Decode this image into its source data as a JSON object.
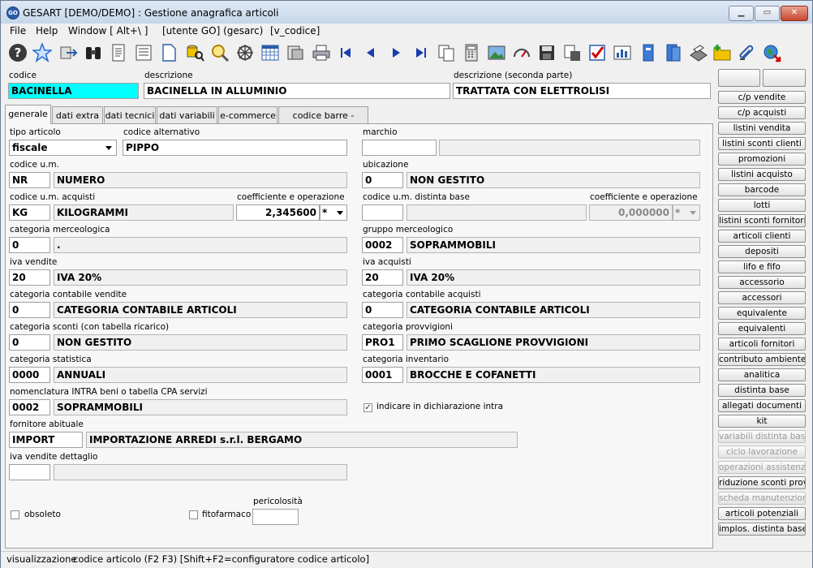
{
  "window": {
    "title": "GESART [DEMO/DEMO] : Gestione anagrafica articoli",
    "app_icon": "GO"
  },
  "menu": [
    "File",
    "Help",
    "Window [ Alt+\\ ]",
    "[utente GO] (gesarc)",
    "[v_codice]"
  ],
  "toolbar_icons": [
    "help-icon",
    "favorite-star-icon",
    "transfer-icon",
    "binoculars-icon",
    "document-list-icon",
    "document-detail-icon",
    "new-document-icon",
    "database-search-icon",
    "search-magnifier-icon",
    "settings-wheel-icon",
    "calendar-grid-icon",
    "database-icon",
    "print-icon",
    "first-record-icon",
    "previous-record-icon",
    "next-record-icon",
    "last-record-icon",
    "copy-icon",
    "calculator-icon",
    "image-icon",
    "gauge-icon",
    "save-icon",
    "save-copy-icon",
    "checklist-icon",
    "chart-icon",
    "file-blue-icon",
    "file-blue-2-icon",
    "scanner-icon",
    "add-folder-icon",
    "attachment-icon",
    "globe-exit-icon"
  ],
  "header": {
    "codice": {
      "label": "codice",
      "value": "BACINELLA"
    },
    "descrizione": {
      "label": "descrizione",
      "value": "BACINELLA IN ALLUMINIO"
    },
    "descrizione2": {
      "label": "descrizione (seconda parte)",
      "value": "TRATTATA CON ELETTROLISI"
    }
  },
  "tabs": [
    {
      "label": "generale",
      "active": true
    },
    {
      "label": "dati extra"
    },
    {
      "label": "dati tecnici"
    },
    {
      "label": "dati variabili"
    },
    {
      "label": "e-commerce"
    },
    {
      "label": "codice barre - colori"
    }
  ],
  "form": {
    "tipo_articolo": {
      "label": "tipo articolo",
      "value": "fiscale"
    },
    "codice_alternativo": {
      "label": "codice alternativo",
      "value": "PIPPO"
    },
    "marchio": {
      "label": "marchio",
      "code": "",
      "desc": ""
    },
    "codice_um": {
      "label": "codice u.m.",
      "code": "NR",
      "desc": "NUMERO"
    },
    "ubicazione": {
      "label": "ubicazione",
      "code": "0",
      "desc": "NON GESTITO"
    },
    "codice_um_acquisti": {
      "label": "codice u.m. acquisti",
      "code": "KG",
      "desc": "KILOGRAMMI"
    },
    "coeff_acquisti": {
      "label": "coefficiente e operazione",
      "value": "2,345600",
      "op": "*"
    },
    "codice_um_distinta": {
      "label": "codice u.m. distinta base",
      "code": "",
      "desc": ""
    },
    "coeff_distinta": {
      "label": "coefficiente e operazione",
      "value": "0,000000",
      "op": "*"
    },
    "categoria_merceologica": {
      "label": "categoria merceologica",
      "code": "0",
      "desc": "."
    },
    "gruppo_merceologico": {
      "label": "gruppo merceologico",
      "code": "0002",
      "desc": "SOPRAMMOBILI"
    },
    "iva_vendite": {
      "label": "iva vendite",
      "code": "20",
      "desc": "IVA 20%"
    },
    "iva_acquisti": {
      "label": "iva acquisti",
      "code": "20",
      "desc": "IVA 20%"
    },
    "cat_contabile_vendite": {
      "label": "categoria contabile vendite",
      "code": "0",
      "desc": "CATEGORIA CONTABILE ARTICOLI"
    },
    "cat_contabile_acquisti": {
      "label": "categoria contabile acquisti",
      "code": "0",
      "desc": "CATEGORIA CONTABILE ARTICOLI"
    },
    "cat_sconti": {
      "label": "categoria sconti (con tabella ricarico)",
      "code": "0",
      "desc": "NON GESTITO"
    },
    "cat_provvigioni": {
      "label": "categoria provvigioni",
      "code": "PRO1",
      "desc": "PRIMO SCAGLIONE PROVVIGIONI"
    },
    "cat_statistica": {
      "label": "categoria statistica",
      "code": "0000",
      "desc": "ANNUALI"
    },
    "cat_inventario": {
      "label": "categoria inventario",
      "code": "0001",
      "desc": "BROCCHE E COFANETTI"
    },
    "nomenclatura_intra": {
      "label": "nomenclatura INTRA beni o tabella CPA servizi",
      "code": "0002",
      "desc": "SOPRAMMOBILI"
    },
    "indicare_intra": {
      "label": "indicare in dichiarazione intra",
      "checked": true
    },
    "fornitore_abituale": {
      "label": "fornitore abituale",
      "code": "IMPORT",
      "desc": "IMPORTAZIONE ARREDI s.r.l. BERGAMO"
    },
    "iva_vendite_dettaglio": {
      "label": "iva vendite dettaglio",
      "code": "",
      "desc": ""
    },
    "obsoleto": {
      "label": "obsoleto",
      "checked": false
    },
    "fitofarmaco": {
      "label": "fitofarmaco",
      "checked": false
    },
    "pericolosita": {
      "label": "pericolosità",
      "value": ""
    }
  },
  "side_buttons": [
    {
      "label": "c/p vendite"
    },
    {
      "label": "c/p acquisti"
    },
    {
      "label": "listini vendita"
    },
    {
      "label": "listini sconti clienti"
    },
    {
      "label": "promozioni"
    },
    {
      "label": "listini acquisto"
    },
    {
      "label": "barcode"
    },
    {
      "label": "lotti"
    },
    {
      "label": "listini sconti fornitori"
    },
    {
      "label": "articoli clienti"
    },
    {
      "label": "depositi"
    },
    {
      "label": "lifo e fifo"
    },
    {
      "label": "accessorio"
    },
    {
      "label": "accessori"
    },
    {
      "label": "equivalente"
    },
    {
      "label": "equivalenti"
    },
    {
      "label": "articoli fornitori"
    },
    {
      "label": "contributo ambiente"
    },
    {
      "label": "analitica"
    },
    {
      "label": "distinta base"
    },
    {
      "label": "allegati documenti"
    },
    {
      "label": "kit"
    },
    {
      "label": "variabili distinta base",
      "disabled": true
    },
    {
      "label": "ciclo lavorazione",
      "disabled": true
    },
    {
      "label": "operazioni assistenza",
      "disabled": true
    },
    {
      "label": "riduzione sconti provv"
    },
    {
      "label": "scheda manutenzioni",
      "disabled": true
    },
    {
      "label": "articoli potenziali"
    },
    {
      "label": "implos. distinta base"
    }
  ],
  "status": {
    "mode": "visualizzazione",
    "hint": "codice articolo (F2 F3) [Shift+F2=configuratore codice articolo]"
  }
}
